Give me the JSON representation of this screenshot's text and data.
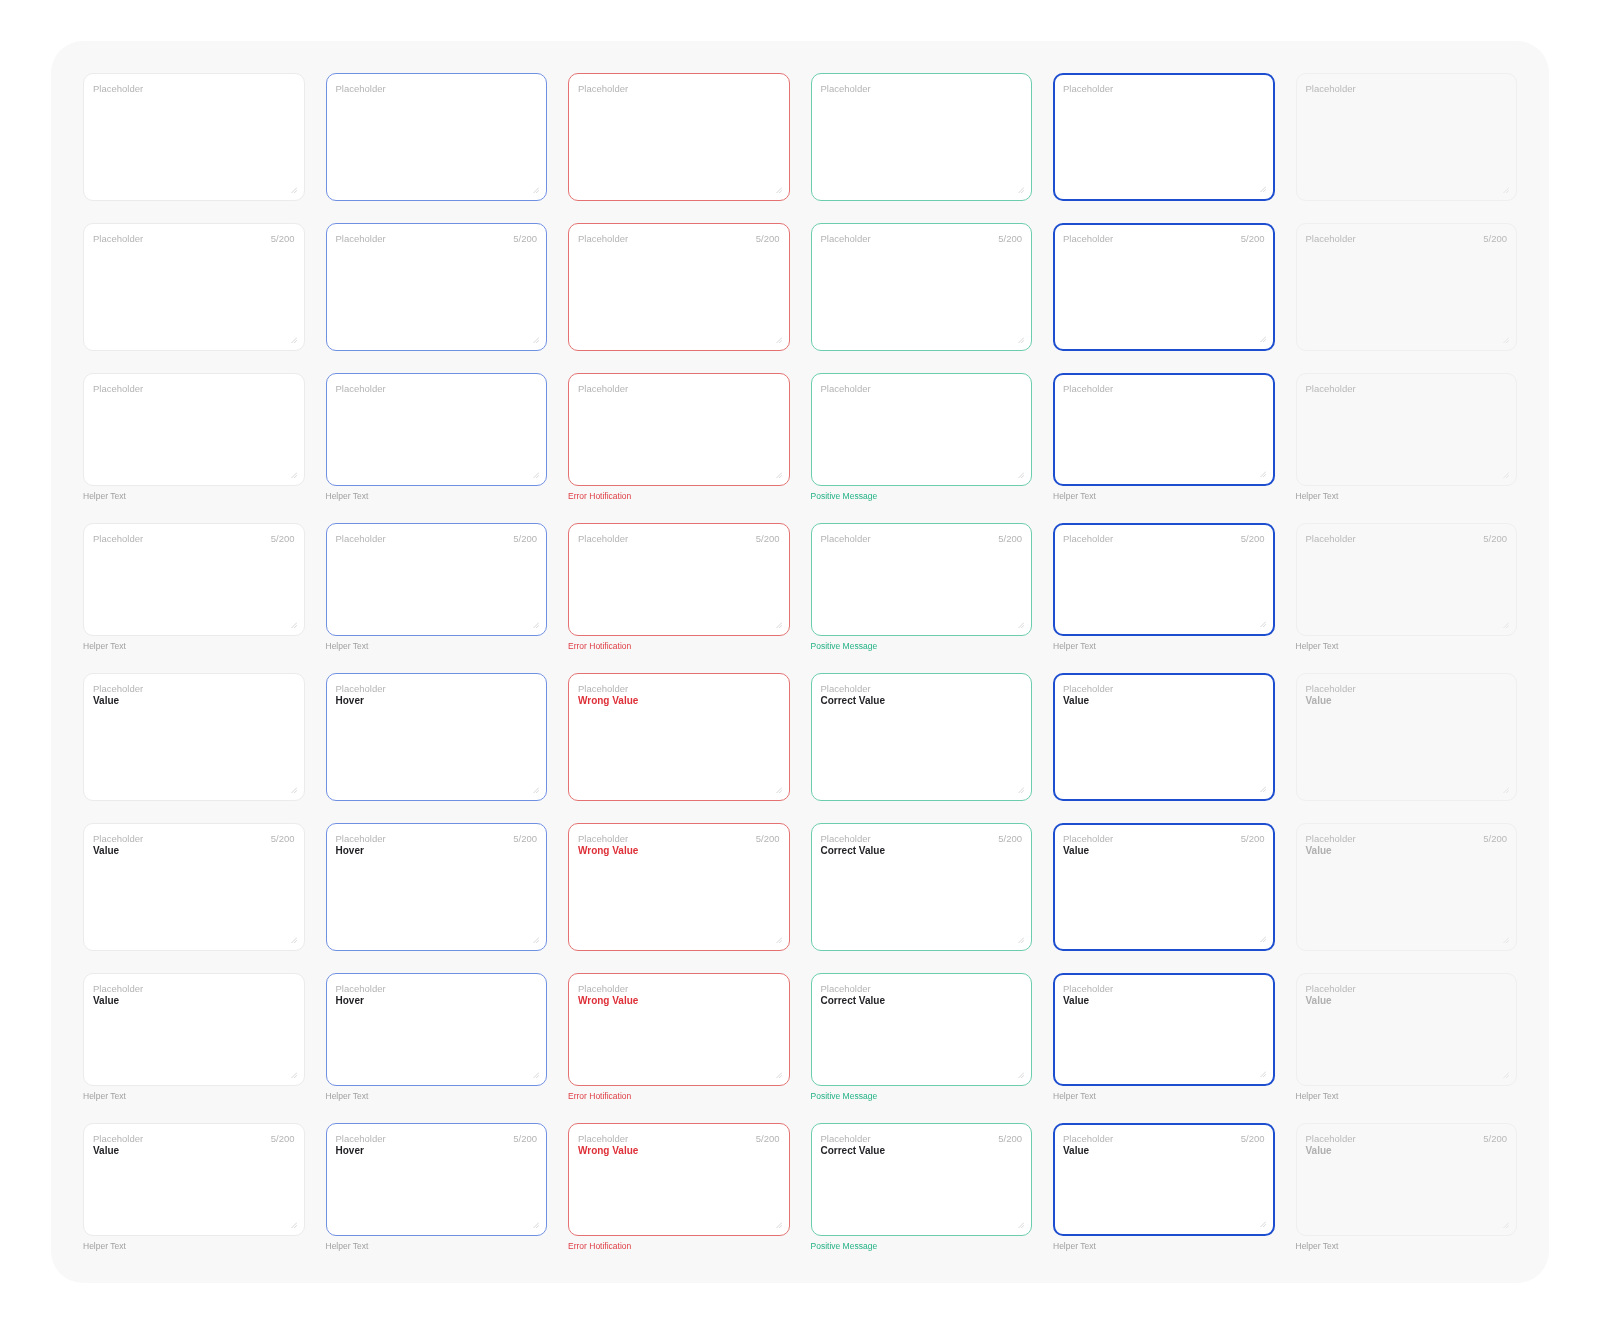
{
  "rows": [
    {
      "fields": [
        {
          "kind": "default",
          "placeholder": "Placeholder"
        },
        {
          "kind": "hover",
          "placeholder": "Placeholder"
        },
        {
          "kind": "error",
          "placeholder": "Placeholder"
        },
        {
          "kind": "success",
          "placeholder": "Placeholder"
        },
        {
          "kind": "focus",
          "placeholder": "Placeholder"
        },
        {
          "kind": "disabled",
          "placeholder": "Placeholder"
        }
      ]
    },
    {
      "fields": [
        {
          "kind": "default",
          "placeholder": "Placeholder",
          "counter": "5/200"
        },
        {
          "kind": "hover",
          "placeholder": "Placeholder",
          "counter": "5/200"
        },
        {
          "kind": "error",
          "placeholder": "Placeholder",
          "counter": "5/200"
        },
        {
          "kind": "success",
          "placeholder": "Placeholder",
          "counter": "5/200"
        },
        {
          "kind": "focus",
          "placeholder": "Placeholder",
          "counter": "5/200"
        },
        {
          "kind": "disabled",
          "placeholder": "Placeholder",
          "counter": "5/200"
        }
      ]
    },
    {
      "fields": [
        {
          "kind": "default",
          "placeholder": "Placeholder",
          "helper": "Helper Text"
        },
        {
          "kind": "hover",
          "placeholder": "Placeholder",
          "helper": "Helper Text"
        },
        {
          "kind": "error",
          "placeholder": "Placeholder",
          "helper": "Error Hotification"
        },
        {
          "kind": "success",
          "placeholder": "Placeholder",
          "helper": "Positive Message"
        },
        {
          "kind": "focus",
          "placeholder": "Placeholder",
          "helper": "Helper Text"
        },
        {
          "kind": "disabled",
          "placeholder": "Placeholder",
          "helper": "Helper Text"
        }
      ]
    },
    {
      "fields": [
        {
          "kind": "default",
          "placeholder": "Placeholder",
          "counter": "5/200",
          "helper": "Helper Text"
        },
        {
          "kind": "hover",
          "placeholder": "Placeholder",
          "counter": "5/200",
          "helper": "Helper Text"
        },
        {
          "kind": "error",
          "placeholder": "Placeholder",
          "counter": "5/200",
          "helper": "Error Hotification"
        },
        {
          "kind": "success",
          "placeholder": "Placeholder",
          "counter": "5/200",
          "helper": "Positive Message"
        },
        {
          "kind": "focus",
          "placeholder": "Placeholder",
          "counter": "5/200",
          "helper": "Helper Text"
        },
        {
          "kind": "disabled",
          "placeholder": "Placeholder",
          "counter": "5/200",
          "helper": "Helper Text"
        }
      ]
    },
    {
      "fields": [
        {
          "kind": "default",
          "placeholder": "Placeholder",
          "value": "Value"
        },
        {
          "kind": "hover",
          "placeholder": "Placeholder",
          "value": "Hover"
        },
        {
          "kind": "error",
          "placeholder": "Placeholder",
          "value": "Wrong Value"
        },
        {
          "kind": "success",
          "placeholder": "Placeholder",
          "value": "Correct Value"
        },
        {
          "kind": "focus",
          "placeholder": "Placeholder",
          "value": "Value"
        },
        {
          "kind": "disabled",
          "placeholder": "Placeholder",
          "value": "Value"
        }
      ]
    },
    {
      "fields": [
        {
          "kind": "default",
          "placeholder": "Placeholder",
          "counter": "5/200",
          "value": "Value"
        },
        {
          "kind": "hover",
          "placeholder": "Placeholder",
          "counter": "5/200",
          "value": "Hover"
        },
        {
          "kind": "error",
          "placeholder": "Placeholder",
          "counter": "5/200",
          "value": "Wrong Value"
        },
        {
          "kind": "success",
          "placeholder": "Placeholder",
          "counter": "5/200",
          "value": "Correct Value"
        },
        {
          "kind": "focus",
          "placeholder": "Placeholder",
          "counter": "5/200",
          "value": "Value"
        },
        {
          "kind": "disabled",
          "placeholder": "Placeholder",
          "counter": "5/200",
          "value": "Value"
        }
      ]
    },
    {
      "fields": [
        {
          "kind": "default",
          "placeholder": "Placeholder",
          "value": "Value",
          "helper": "Helper Text"
        },
        {
          "kind": "hover",
          "placeholder": "Placeholder",
          "value": "Hover",
          "helper": "Helper Text"
        },
        {
          "kind": "error",
          "placeholder": "Placeholder",
          "value": "Wrong Value",
          "helper": "Error Hotification"
        },
        {
          "kind": "success",
          "placeholder": "Placeholder",
          "value": "Correct Value",
          "helper": "Positive Message"
        },
        {
          "kind": "focus",
          "placeholder": "Placeholder",
          "value": "Value",
          "helper": "Helper Text"
        },
        {
          "kind": "disabled",
          "placeholder": "Placeholder",
          "value": "Value",
          "helper": "Helper Text"
        }
      ]
    },
    {
      "fields": [
        {
          "kind": "default",
          "placeholder": "Placeholder",
          "counter": "5/200",
          "value": "Value",
          "helper": "Helper Text"
        },
        {
          "kind": "hover",
          "placeholder": "Placeholder",
          "counter": "5/200",
          "value": "Hover",
          "helper": "Helper Text"
        },
        {
          "kind": "error",
          "placeholder": "Placeholder",
          "counter": "5/200",
          "value": "Wrong Value",
          "helper": "Error Hotification"
        },
        {
          "kind": "success",
          "placeholder": "Placeholder",
          "counter": "5/200",
          "value": "Correct Value",
          "helper": "Positive Message"
        },
        {
          "kind": "focus",
          "placeholder": "Placeholder",
          "counter": "5/200",
          "value": "Value",
          "helper": "Helper Text"
        },
        {
          "kind": "disabled",
          "placeholder": "Placeholder",
          "counter": "5/200",
          "value": "Value",
          "helper": "Helper Text"
        }
      ]
    }
  ]
}
